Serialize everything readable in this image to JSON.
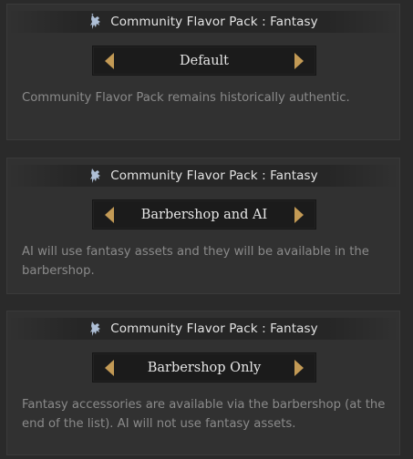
{
  "options": [
    {
      "title": "Community Flavor Pack : Fantasy",
      "value": "Default",
      "description": "Community Flavor Pack remains historically authentic."
    },
    {
      "title": "Community Flavor Pack : Fantasy",
      "value": "Barbershop and AI",
      "description": "AI will use fantasy assets and they will be available in the barbershop."
    },
    {
      "title": "Community Flavor Pack : Fantasy",
      "value": "Barbershop Only",
      "description": "Fantasy accessories are available via the barbershop (at the end of the list). AI will not use fantasy assets."
    }
  ],
  "icons": {
    "header": "unicorn-icon",
    "prev": "arrow-left-icon",
    "next": "arrow-right-icon"
  },
  "colors": {
    "arrow": "#c39a55",
    "icon": "#aebfd6"
  }
}
